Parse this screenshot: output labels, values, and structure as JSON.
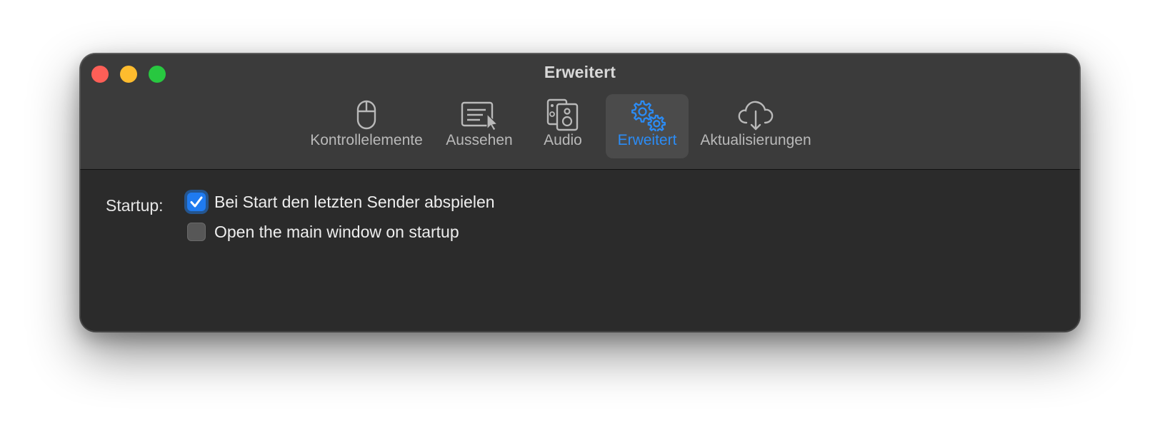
{
  "window": {
    "title": "Erweitert"
  },
  "toolbar": {
    "tabs": [
      {
        "label": "Kontrollelemente",
        "icon": "mouse-icon",
        "selected": false
      },
      {
        "label": "Aussehen",
        "icon": "screen-pointer-icon",
        "selected": false
      },
      {
        "label": "Audio",
        "icon": "speaker-icon",
        "selected": false
      },
      {
        "label": "Erweitert",
        "icon": "gears-icon",
        "selected": true
      },
      {
        "label": "Aktualisierungen",
        "icon": "cloud-download-icon",
        "selected": false
      }
    ]
  },
  "settings": {
    "startup_label": "Startup:",
    "options": [
      {
        "label": "Bei Start den letzten Sender abspielen",
        "checked": true
      },
      {
        "label": "Open the main window on startup",
        "checked": false
      }
    ]
  },
  "colors": {
    "accent": "#2b8cf6",
    "toolbar_bg": "#3b3b3b",
    "content_bg": "#2b2b2b",
    "close": "#fe5f57",
    "minimize": "#febc2e",
    "maximize": "#28c840"
  }
}
